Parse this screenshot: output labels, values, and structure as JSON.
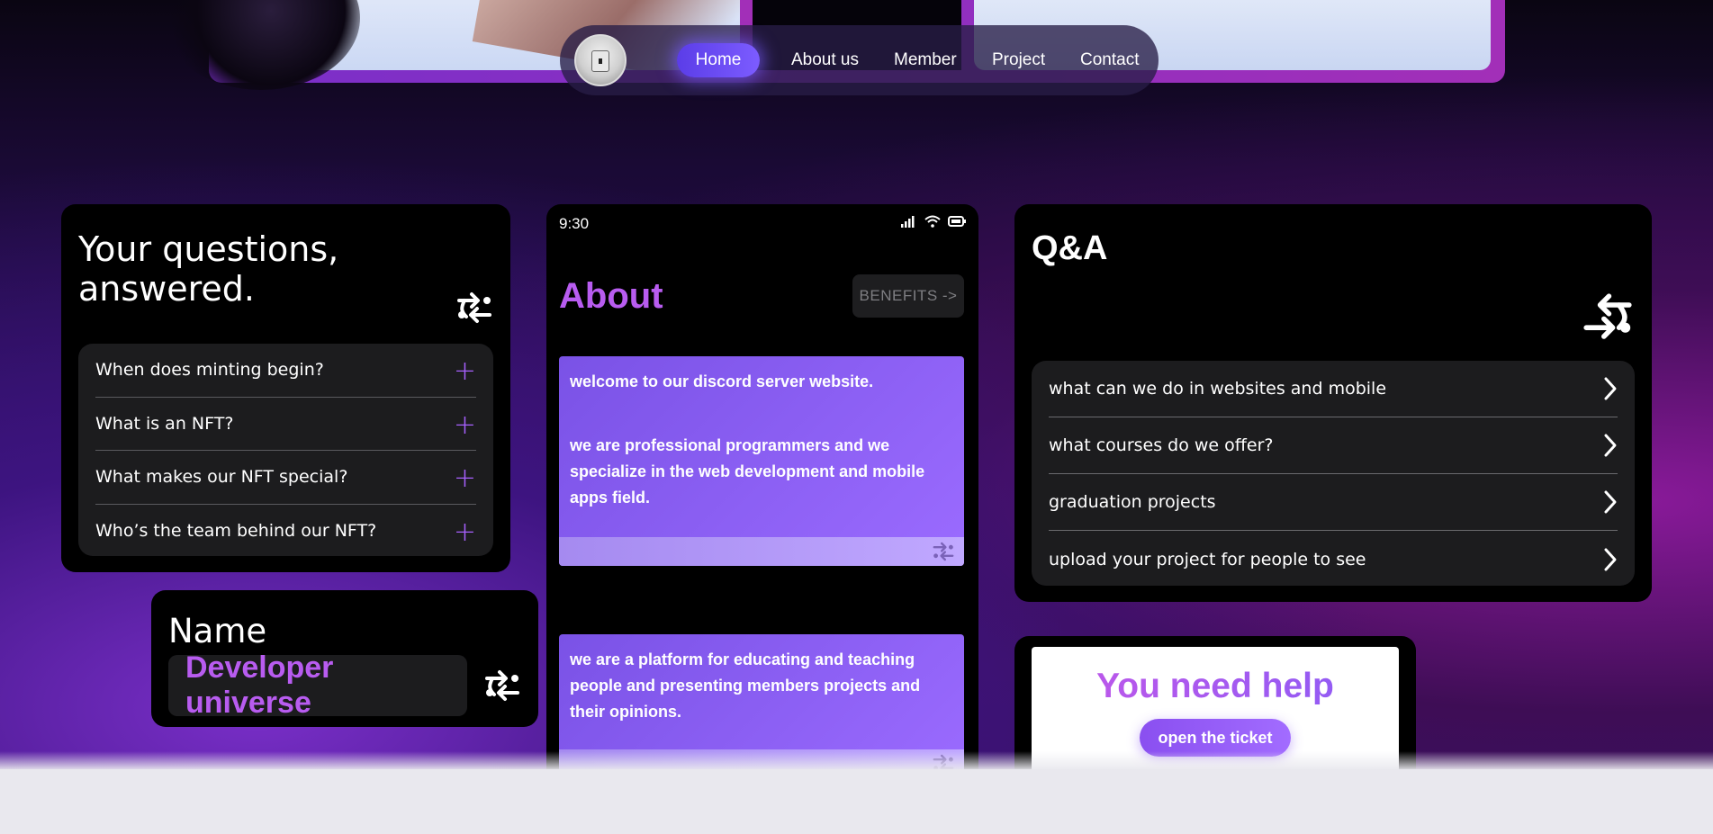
{
  "nav": {
    "items": [
      "Home",
      "About us",
      "Member",
      "Project",
      "Contact"
    ],
    "active": "Home"
  },
  "faq": {
    "title": "Your questions, answered.",
    "items": [
      "When does minting begin?",
      "What is an NFT?",
      "What makes our NFT special?",
      "Who’s the team behind our NFT?"
    ]
  },
  "name_card": {
    "label": "Name",
    "value": "Developer universe"
  },
  "phone": {
    "time": "9:30",
    "about_title": "About",
    "benefits_label": "BENEFITS ->",
    "panel1_line1": "welcome to our discord server website.",
    "panel1_line2": "we are professional programmers and we specialize in the web development and mobile apps field.",
    "panel2_text": "we are a platform for educating and teaching people and presenting members projects and their opinions."
  },
  "qa": {
    "title": "Q&A",
    "items": [
      "what can we do in websites and mobile",
      "what courses do we offer?",
      "graduation projects",
      "upload your project for people to see"
    ]
  },
  "help": {
    "title": "You need help",
    "button": "open the ticket"
  },
  "colors": {
    "accent": "#b85cf0",
    "plus": "#a860ff",
    "nav_active": "#5b3de8",
    "card_bg": "#000000",
    "list_bg": "#1c1c1e"
  },
  "icons": {
    "swap": "swap-arrows-icon",
    "chevron": "chevron-right-icon",
    "plus": "plus-icon",
    "signal": "signal-icon",
    "wifi": "wifi-icon",
    "battery": "battery-icon"
  }
}
